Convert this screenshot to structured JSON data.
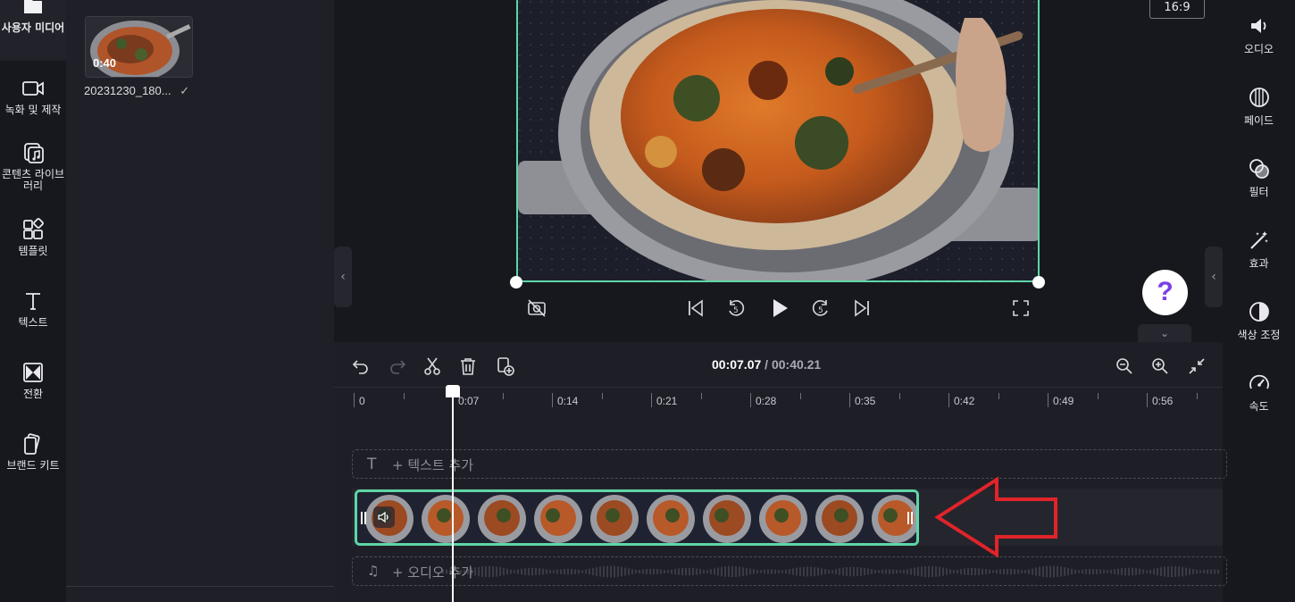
{
  "leftnav": {
    "items": [
      {
        "label": "사용자 미디어",
        "icon": "folder-icon"
      },
      {
        "label": "녹화 및 제작",
        "icon": "camera-icon"
      },
      {
        "label": "콘텐츠 라이브러리",
        "icon": "library-icon"
      },
      {
        "label": "템플릿",
        "icon": "template-icon"
      },
      {
        "label": "텍스트",
        "icon": "text-icon"
      },
      {
        "label": "전환",
        "icon": "transition-icon"
      },
      {
        "label": "브랜드 키트",
        "icon": "brand-kit-icon"
      }
    ]
  },
  "media": {
    "thumb_duration": "0:40",
    "thumb_name": "20231230_180...",
    "thumb_check": "✓"
  },
  "preview": {
    "aspect_ratio": "16:9",
    "help": "?"
  },
  "rightnav": {
    "items": [
      {
        "label": "오디오",
        "icon": "audio-icon"
      },
      {
        "label": "페이드",
        "icon": "fade-icon"
      },
      {
        "label": "필터",
        "icon": "filter-icon"
      },
      {
        "label": "효과",
        "icon": "effects-icon"
      },
      {
        "label": "색상 조정",
        "icon": "color-adjust-icon"
      },
      {
        "label": "속도",
        "icon": "speed-icon"
      }
    ]
  },
  "timeline": {
    "current_time": "00:07.07",
    "separator": " / ",
    "total_time": "00:40.21",
    "ticks": [
      "0",
      "0:07",
      "0:14",
      "0:21",
      "0:28",
      "0:35",
      "0:42",
      "0:49",
      "0:56"
    ],
    "add_text": "+ 텍스트 추가",
    "add_audio": "+ 오디오 추가"
  },
  "colors": {
    "accent": "#5ed6a7",
    "annotation_arrow": "#e0242a",
    "help_icon": "#7b3fe4"
  }
}
